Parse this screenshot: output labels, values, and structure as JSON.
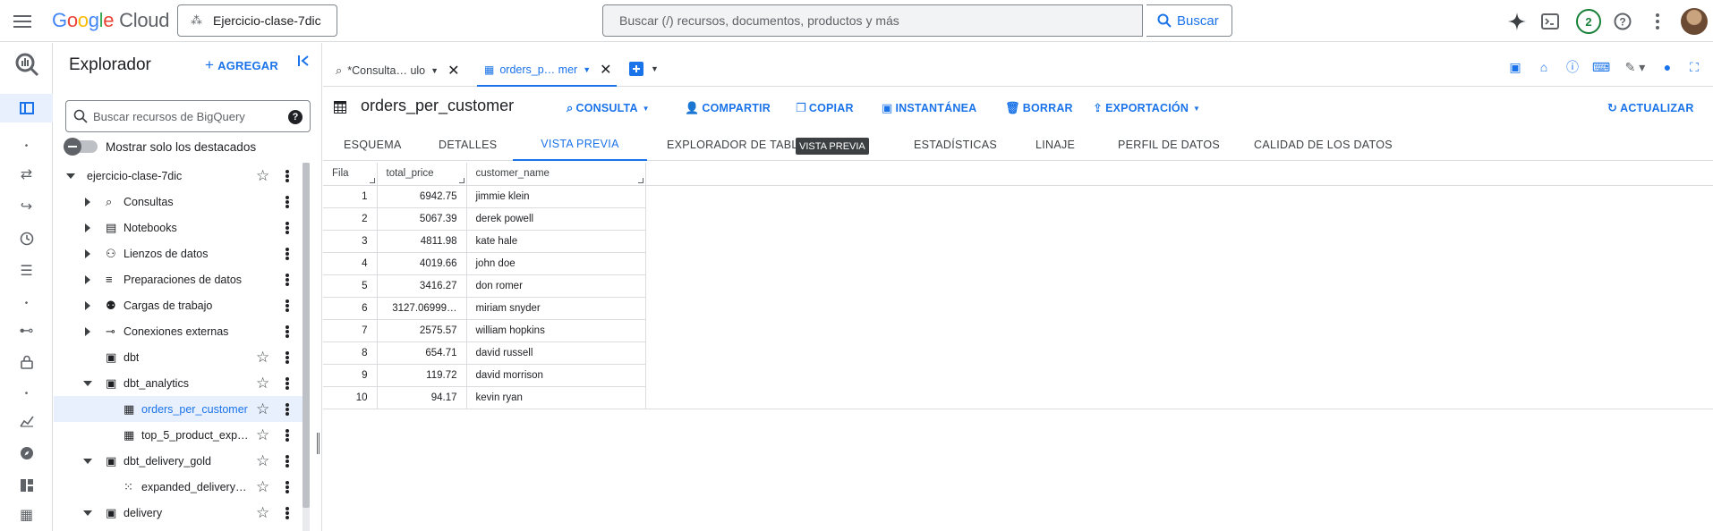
{
  "topbar": {
    "logo_google": [
      "G",
      "o",
      "o",
      "g",
      "l",
      "e"
    ],
    "logo_cloud": "Cloud",
    "project": "Ejercicio-clase-7dic",
    "search_placeholder": "Buscar (/) recursos, documentos, productos y más",
    "search_button": "Buscar",
    "notification_count": "2"
  },
  "explorer": {
    "title": "Explorador",
    "add": "AGREGAR",
    "search_placeholder": "Buscar recursos de BigQuery",
    "help": "?",
    "toggle_label": "Mostrar solo los destacados",
    "nodes": [
      {
        "label": "ejercicio-clase-7dic",
        "level": 0,
        "caret": "down",
        "icon": "",
        "star": true
      },
      {
        "label": "Consultas",
        "level": 1,
        "caret": "right",
        "icon": "query-icon",
        "star": false
      },
      {
        "label": "Notebooks",
        "level": 1,
        "caret": "right",
        "icon": "notebook-icon",
        "star": false
      },
      {
        "label": "Lienzos de datos",
        "level": 1,
        "caret": "right",
        "icon": "canvas-icon",
        "star": false
      },
      {
        "label": "Preparaciones de datos",
        "level": 1,
        "caret": "right",
        "icon": "data-prep-icon",
        "star": false
      },
      {
        "label": "Cargas de trabajo",
        "level": 1,
        "caret": "right",
        "icon": "workload-icon",
        "star": false
      },
      {
        "label": "Conexiones externas",
        "level": 1,
        "caret": "right",
        "icon": "connection-icon",
        "star": false
      },
      {
        "label": "dbt",
        "level": 1,
        "caret": "",
        "icon": "dataset-icon",
        "star": true
      },
      {
        "label": "dbt_analytics",
        "level": 1,
        "caret": "down",
        "icon": "dataset-icon",
        "star": true
      },
      {
        "label": "orders_per_customer",
        "level": 2,
        "caret": "",
        "icon": "table-icon",
        "star": true,
        "selected": true
      },
      {
        "label": "top_5_product_expe…",
        "level": 2,
        "caret": "",
        "icon": "table-icon",
        "star": true
      },
      {
        "label": "dbt_delivery_gold",
        "level": 1,
        "caret": "down",
        "icon": "dataset-icon",
        "star": true
      },
      {
        "label": "expanded_delivery_e…",
        "level": 2,
        "caret": "",
        "icon": "view-icon",
        "star": true
      },
      {
        "label": "delivery",
        "level": 1,
        "caret": "down",
        "icon": "dataset-icon",
        "star": true
      }
    ]
  },
  "editor_tabs": [
    {
      "label": "*Consulta… ulo",
      "icon": "query-icon",
      "active": false
    },
    {
      "label": "orders_p… mer",
      "icon": "table-icon",
      "active": true
    }
  ],
  "table_view": {
    "name": "orders_per_customer",
    "actions": [
      "CONSULTA",
      "COMPARTIR",
      "COPIAR",
      "INSTANTÁNEA",
      "BORRAR",
      "EXPORTACIÓN",
      "ACTUALIZAR"
    ],
    "subtabs": [
      "ESQUEMA",
      "DETALLES",
      "VISTA PREVIA",
      "EXPLORADOR DE TABLAS",
      "ESTADÍSTICAS",
      "LINAJE",
      "PERFIL DE DATOS",
      "CALIDAD DE LOS DATOS"
    ],
    "active_subtab": "VISTA PREVIA",
    "tooltip": "VISTA PREVIA",
    "columns": [
      "Fila",
      "total_price",
      "customer_name"
    ],
    "rows": [
      [
        "1",
        "6942.75",
        "jimmie klein"
      ],
      [
        "2",
        "5067.39",
        "derek powell"
      ],
      [
        "3",
        "4811.98",
        "kate hale"
      ],
      [
        "4",
        "4019.66",
        "john doe"
      ],
      [
        "5",
        "3416.27",
        "don romer"
      ],
      [
        "6",
        "3127.06999…",
        "miriam snyder"
      ],
      [
        "7",
        "2575.57",
        "william hopkins"
      ],
      [
        "8",
        "654.71",
        "david russell"
      ],
      [
        "9",
        "119.72",
        "david morrison"
      ],
      [
        "10",
        "94.17",
        "kevin ryan"
      ]
    ]
  }
}
